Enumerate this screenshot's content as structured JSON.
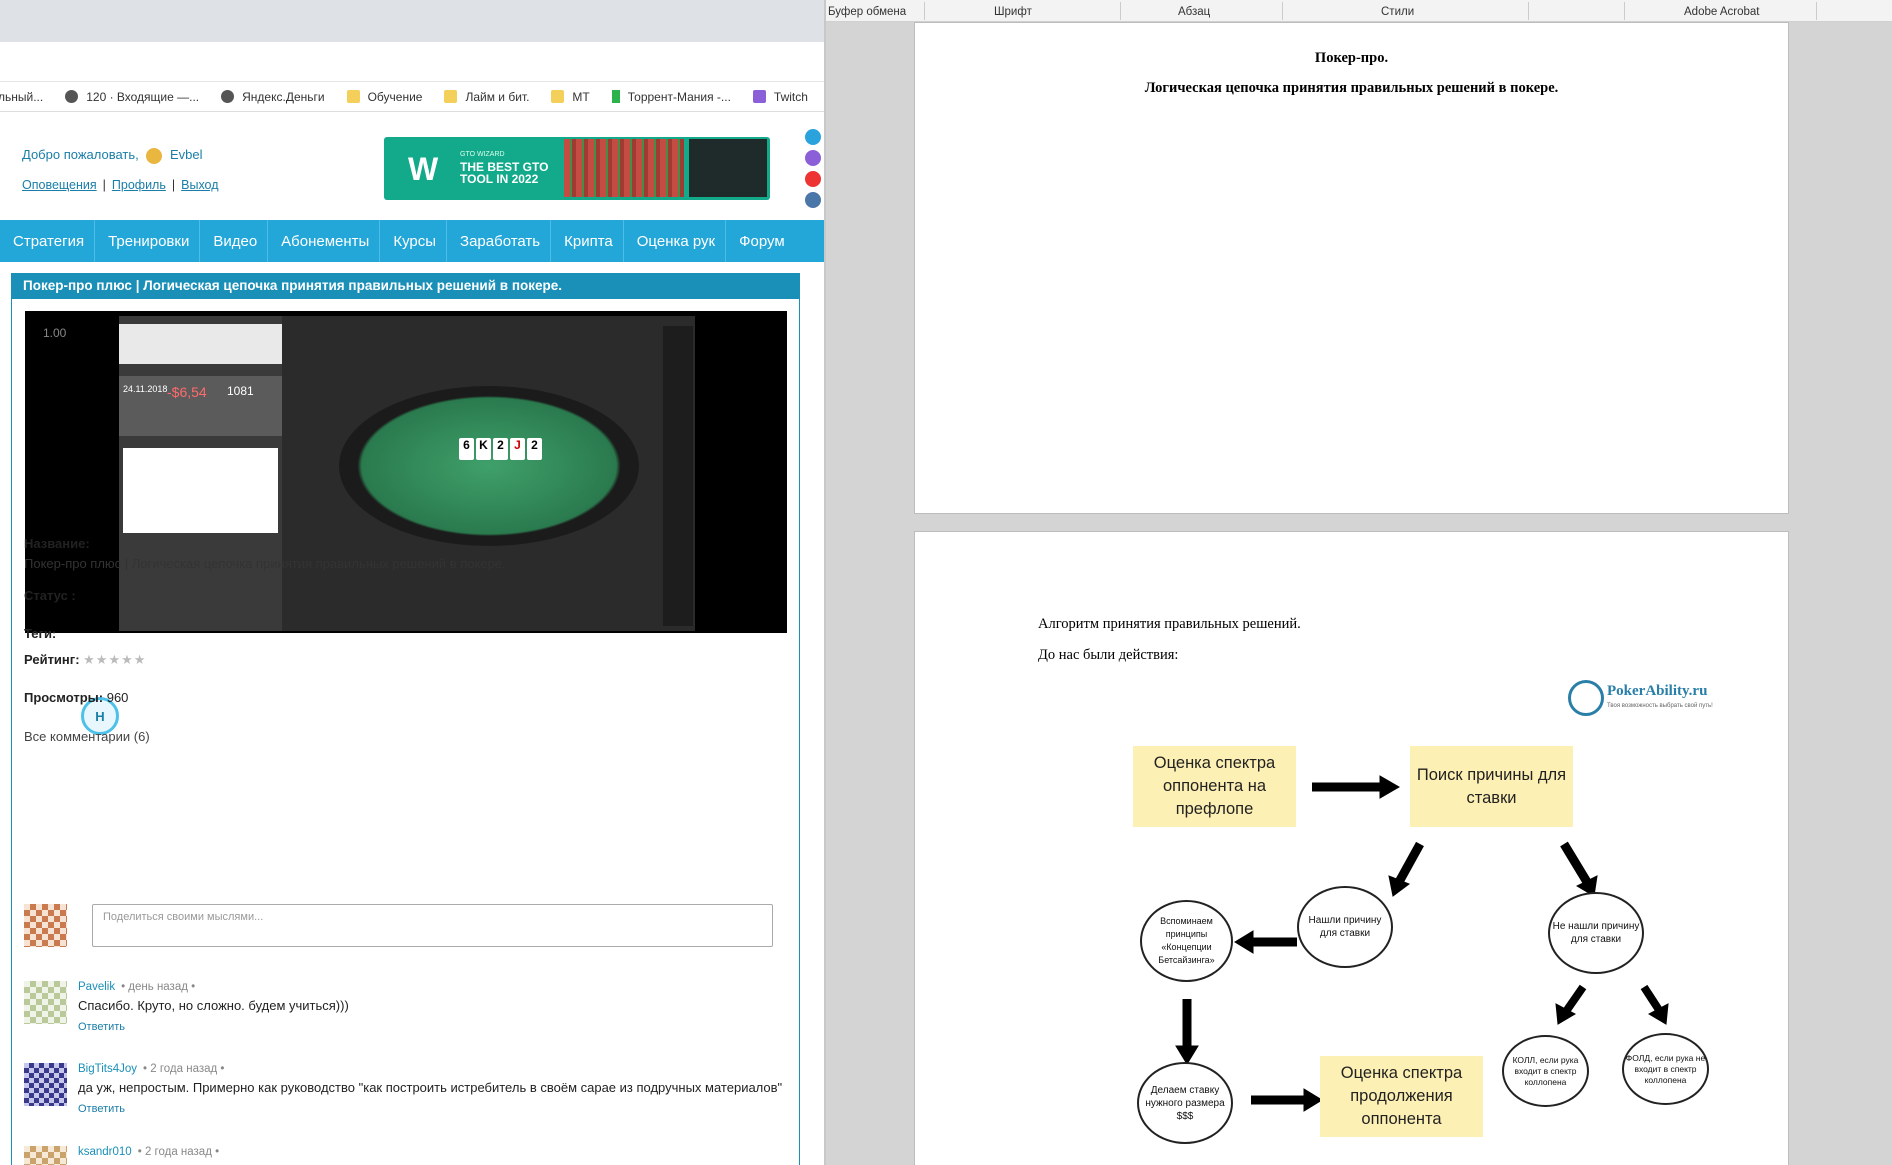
{
  "browser": {
    "bookmarks": [
      {
        "label": "льный...",
        "icon": "none"
      },
      {
        "label": "120 · Входящие —...",
        "icon": "globe-icon"
      },
      {
        "label": "Яндекс.Деньги",
        "icon": "globe-icon"
      },
      {
        "label": "Обучение",
        "icon": "folder-icon"
      },
      {
        "label": "Лайм и бит.",
        "icon": "folder-icon"
      },
      {
        "label": "МТ",
        "icon": "folder-icon"
      },
      {
        "label": "Торрент-Мания -...",
        "icon": "torrent-icon"
      },
      {
        "label": "Twitch",
        "icon": "twitch-icon"
      }
    ]
  },
  "site": {
    "welcome": "Добро пожаловать,",
    "username": "Evbel",
    "links": {
      "notifications": "Оповещения",
      "profile": "Профиль",
      "logout": "Выход"
    },
    "banner": {
      "logo": "W",
      "subtitle": "GTO WIZARD",
      "headline": "THE BEST GTO TOOL IN 2022"
    },
    "nav": [
      "Стратегия",
      "Тренировки",
      "Видео",
      "Абонементы",
      "Курсы",
      "Заработать",
      "Крипта",
      "Оценка рук",
      "Форум"
    ],
    "content_title": "Покер-про плюс | Логическая цепочка принятия правильных решений в покере.",
    "video": {
      "timestamp": "1.00",
      "stat_date": "24.11.2018",
      "stat_value": "-$6,54",
      "stat_hands": "1081",
      "board": [
        "6",
        "K",
        "2",
        "J",
        "2"
      ]
    },
    "fields": {
      "name_label": "Название:",
      "name_value": "Покер-про плюс |  Логическая цепочка принятия правильных решений в покере.",
      "status_label": "Статус :",
      "status_value": "Н",
      "tags_label": "Теги:",
      "rating_label": "Рейтинг:",
      "rating_stars": "★★★★★",
      "views_label": "Просмотры:",
      "views_value": "960"
    },
    "comments_header": "Все комментарии (6)",
    "comment_placeholder": "Поделиться своими мыслями...",
    "comments": [
      {
        "author": "Pavelik",
        "time": "• день назад •",
        "text": "Спасибо. Круто, но сложно. будем учиться)))",
        "reply": "Ответить"
      },
      {
        "author": "BigTits4Joy",
        "time": "• 2 года назад •",
        "text": "да уж, непростым. Примерно как руководство \"как построить истребитель в своём сарае из подручных материалов\"",
        "reply": "Ответить"
      },
      {
        "author": "ksandr010",
        "time": "• 2 года назад •",
        "text": "",
        "reply": ""
      }
    ]
  },
  "word": {
    "ribbon_groups": [
      "Буфер обмена",
      "Шрифт",
      "Абзац",
      "Стили",
      "Adobe Acrobat"
    ],
    "page1": {
      "title": "Покер-про.",
      "subtitle": "Логическая цепочка принятия правильных решений в покере."
    },
    "page2": {
      "line1": "Алгоритм принятия правильных решений.",
      "line2": "До нас были действия:",
      "logo_name": "PokerAbility.ru",
      "logo_tagline": "Твоя возможность выбрать свой путь!",
      "flow": {
        "box1": "Оценка спектра оппонента на префлопе",
        "box2": "Поиск причины для ставки",
        "found": "Нашли причину для ставки",
        "notfound": "Не нашли причину для ставки",
        "recall": "Вспоминаем принципы «Концепции Бетсайзинга»",
        "bet": "Делаем ставку нужного размера $$$",
        "box3": "Оценка спектра продолжения оппонента",
        "call": "КОЛЛ, если рука входит в спектр коллопена",
        "fold": "ФОЛД, если рука не входит в спектр коллопена"
      }
    }
  }
}
